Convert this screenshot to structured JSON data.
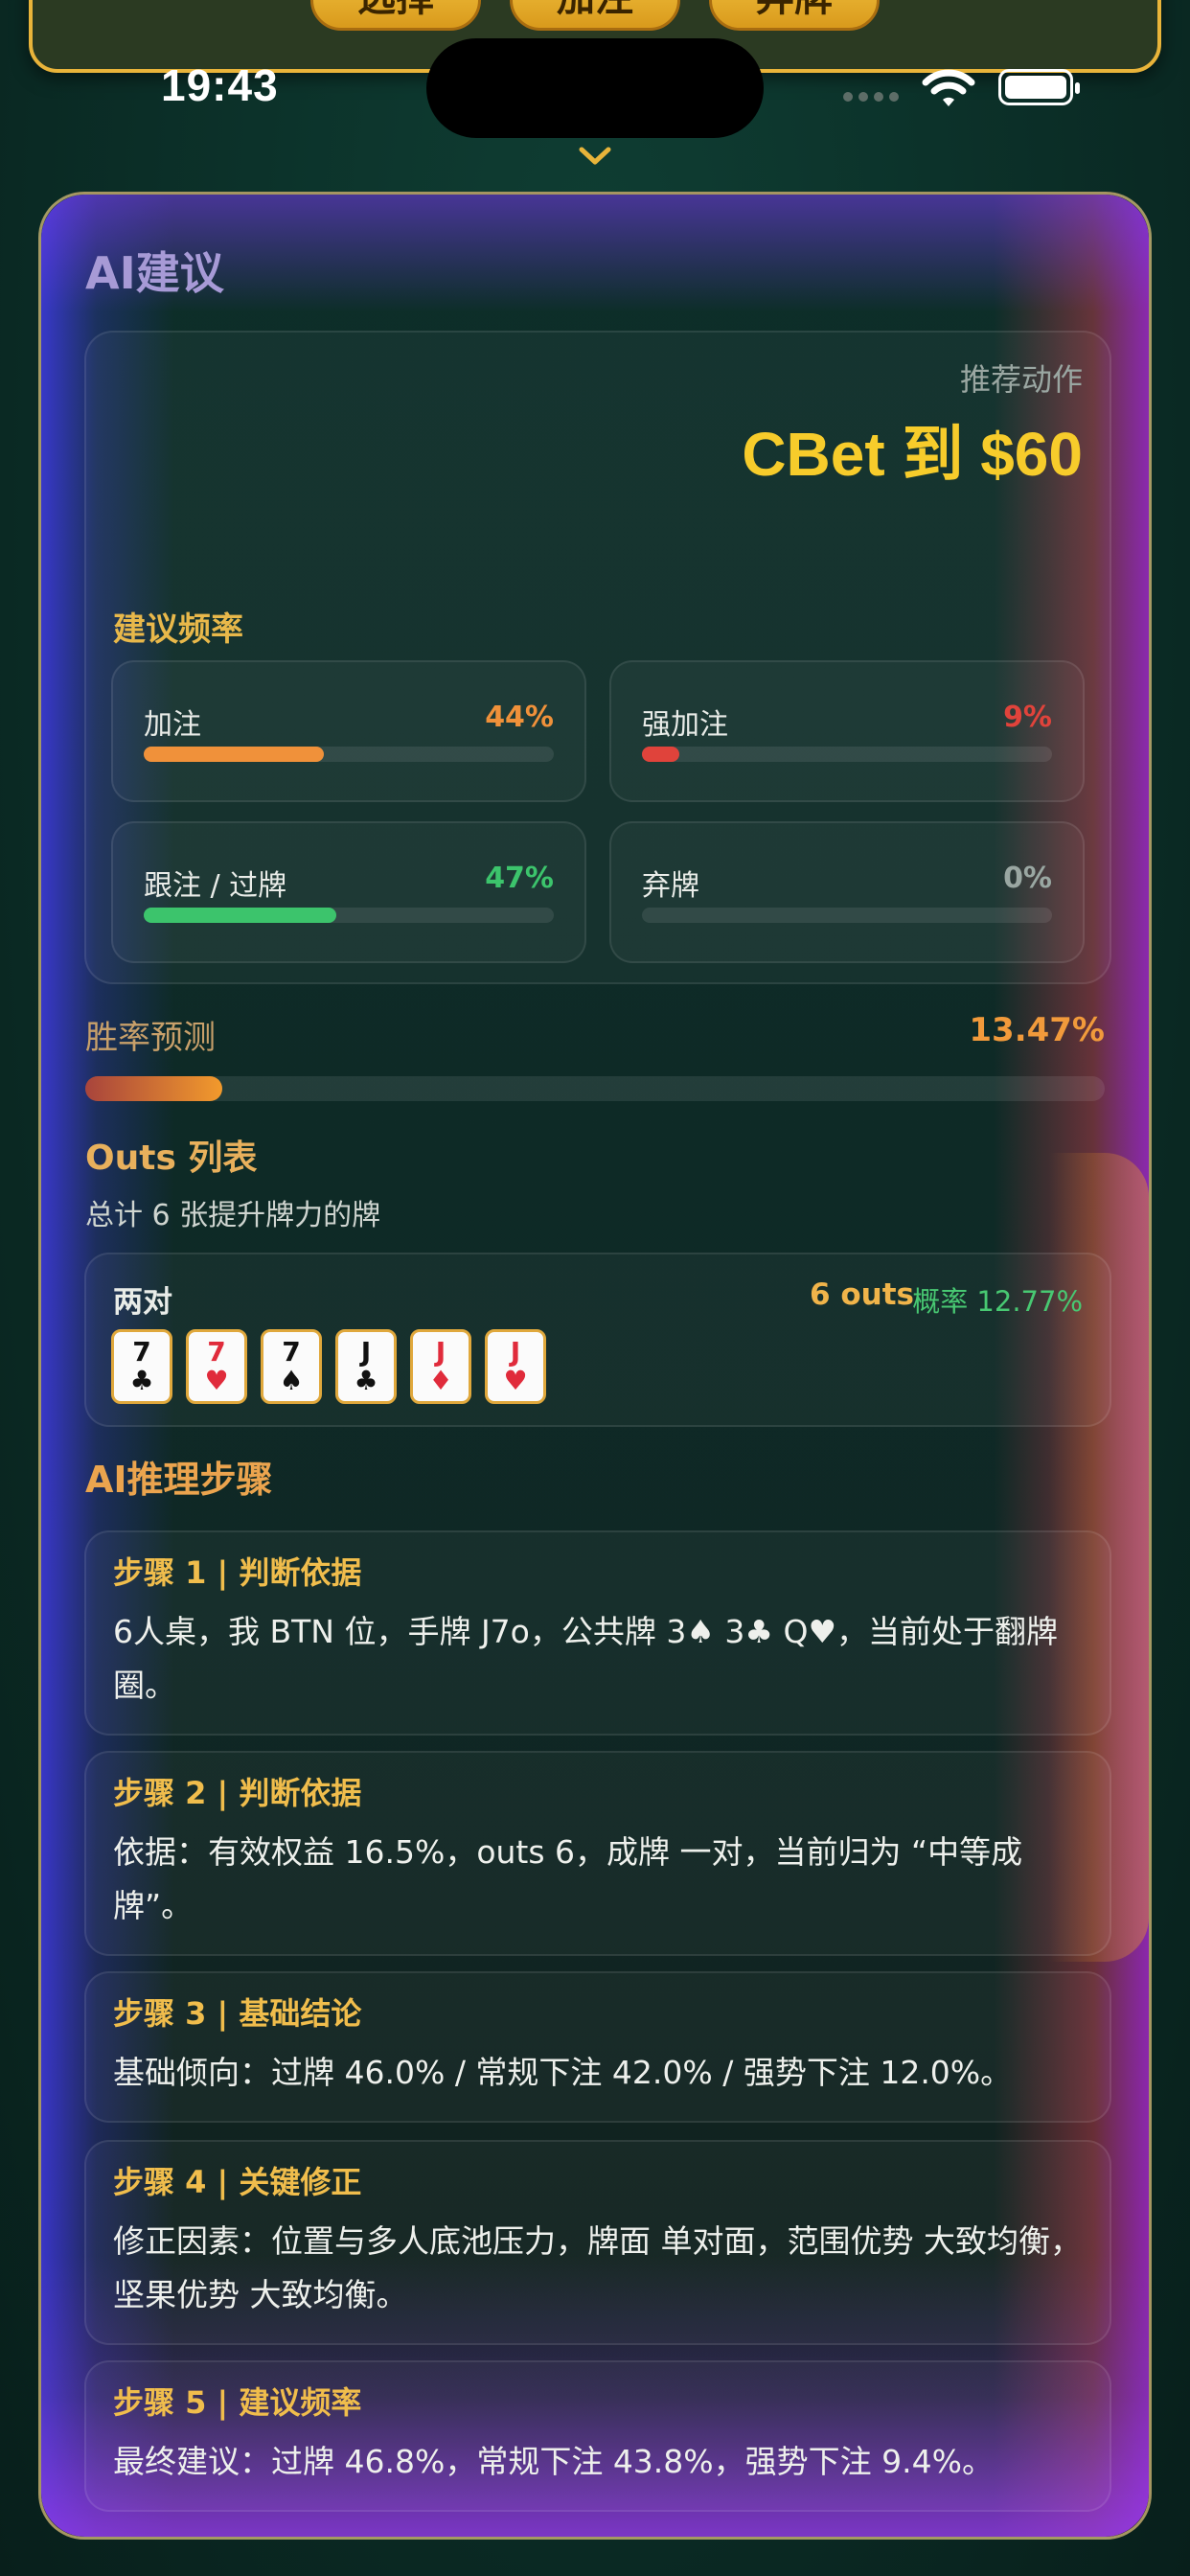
{
  "top_buttons": [
    "选择",
    "加注",
    "弃牌"
  ],
  "status": {
    "time": "19:43"
  },
  "card": {
    "title": "AI建议",
    "recommend_label": "推荐动作",
    "recommend_action": "CBet 到 $60",
    "freq_title": "建议频率",
    "freq": [
      {
        "name": "加注",
        "pct": "44%",
        "value": 0.44,
        "color": "#f0913a"
      },
      {
        "name": "强加注",
        "pct": "9%",
        "value": 0.09,
        "color": "#e0433b"
      },
      {
        "name": "跟注 / 过牌",
        "pct": "47%",
        "value": 0.47,
        "color": "#3cc46c"
      },
      {
        "name": "弃牌",
        "pct": "0%",
        "value": 0.0,
        "color": "#9aa7a2"
      }
    ],
    "win_label": "胜率预测",
    "win_value": "13.47%",
    "win_fraction": 0.1347,
    "outs_title": "Outs 列表",
    "outs_sub": "总计 6 张提升牌力的牌",
    "outs_group": {
      "name": "两对",
      "count": "6 outs",
      "prob": "概率 12.77%",
      "cards": [
        {
          "rank": "7",
          "suit": "♣",
          "color": "black"
        },
        {
          "rank": "7",
          "suit": "♥",
          "color": "red"
        },
        {
          "rank": "7",
          "suit": "♠",
          "color": "black"
        },
        {
          "rank": "J",
          "suit": "♣",
          "color": "black"
        },
        {
          "rank": "J",
          "suit": "♦",
          "color": "red"
        },
        {
          "rank": "J",
          "suit": "♥",
          "color": "red"
        }
      ]
    },
    "steps_title": "AI推理步骤",
    "steps": [
      {
        "title": "步骤 1 | 判断依据",
        "text": "6人桌，我 BTN 位，手牌 J7o，公共牌 3♠ 3♣ Q♥，当前处于翻牌圈。"
      },
      {
        "title": "步骤 2 | 判断依据",
        "text": "依据：有效权益 16.5%，outs 6，成牌 一对，当前归为 “中等成牌”。"
      },
      {
        "title": "步骤 3 | 基础结论",
        "text": "基础倾向：过牌 46.0% / 常规下注 42.0% / 强势下注 12.0%。"
      },
      {
        "title": "步骤 4 | 关键修正",
        "text": "修正因素：位置与多人底池压力，牌面 单对面，范围优势 大致均衡，坚果优势 大致均衡。"
      },
      {
        "title": "步骤 5 | 建议频率",
        "text": "最终建议：过牌 46.8%，常规下注 43.8%，强势下注 9.4%。"
      }
    ]
  }
}
